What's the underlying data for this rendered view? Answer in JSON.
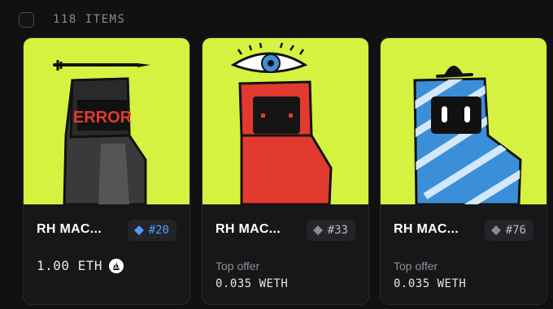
{
  "header": {
    "item_count": "118 ITEMS"
  },
  "colors": {
    "art_bg": "#d6f240",
    "verified_blue": "#4d9ef7",
    "badge_gray": "#8a8a90"
  },
  "cards": [
    {
      "name": "RH MAC...",
      "token": "#20",
      "badge_icon": "diamond-icon",
      "badge_color": "#4d9ef7",
      "price": "1.00 ETH",
      "price_label": "",
      "marketplace_icon": "opensea-icon"
    },
    {
      "name": "RH MAC...",
      "token": "#33",
      "badge_icon": "diamond-icon",
      "badge_color": "#8a8a90",
      "price_label": "Top offer",
      "price": "0.035 WETH"
    },
    {
      "name": "RH MAC...",
      "token": "#76",
      "badge_icon": "diamond-icon",
      "badge_color": "#8a8a90",
      "price_label": "Top offer",
      "price": "0.035 WETH"
    }
  ]
}
